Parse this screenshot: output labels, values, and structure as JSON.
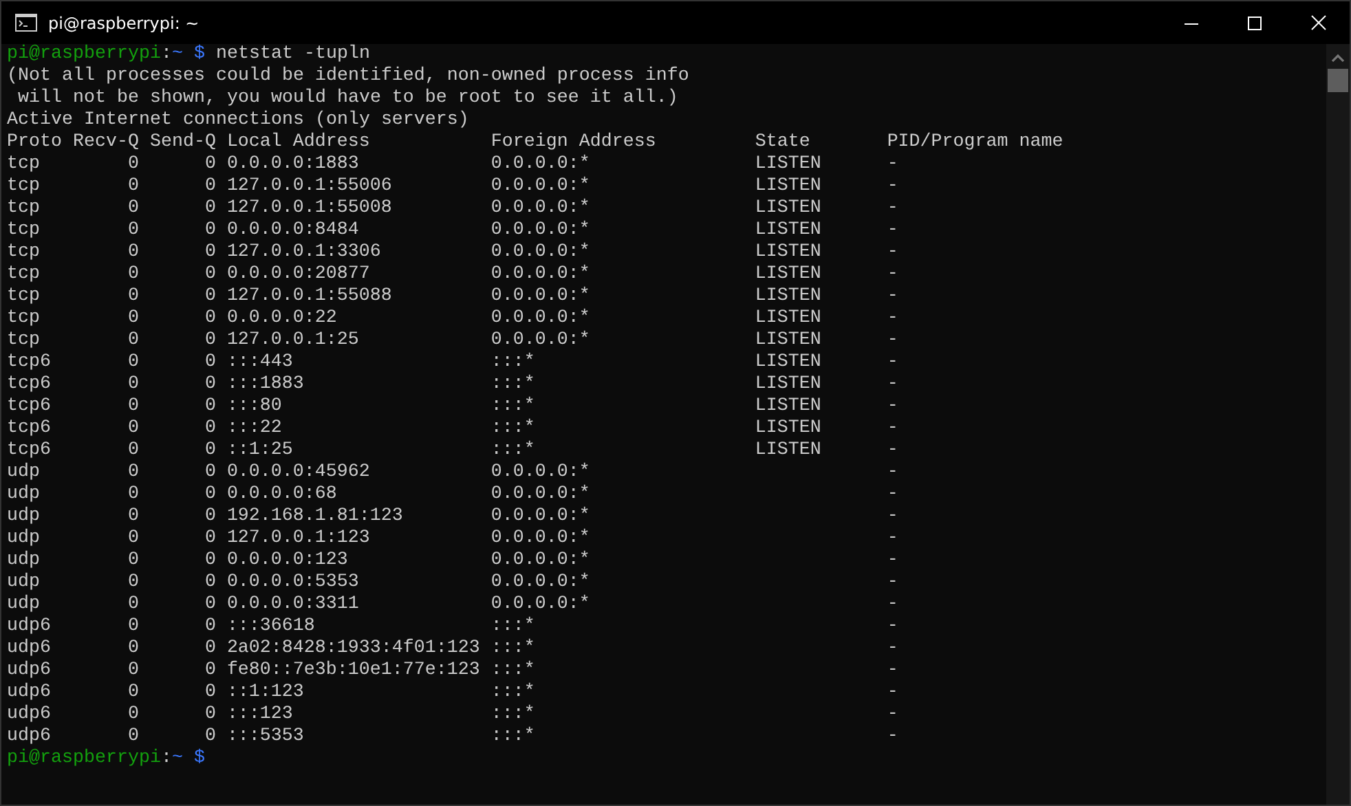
{
  "window": {
    "title": "pi@raspberrypi: ~"
  },
  "command": {
    "user_host": "pi@raspberrypi",
    "separator": ":",
    "path": "~",
    "symbol": "$",
    "text": "netstat -tupln"
  },
  "messages": [
    "(Not all processes could be identified, non-owned process info",
    " will not be shown, you would have to be root to see it all.)",
    "Active Internet connections (only servers)"
  ],
  "table": {
    "columns": [
      "Proto",
      "Recv-Q",
      "Send-Q",
      "Local Address",
      "Foreign Address",
      "State",
      "PID/Program name"
    ],
    "rows": [
      [
        "tcp",
        "0",
        "0",
        "0.0.0.0:1883",
        "0.0.0.0:*",
        "LISTEN",
        "-"
      ],
      [
        "tcp",
        "0",
        "0",
        "127.0.0.1:55006",
        "0.0.0.0:*",
        "LISTEN",
        "-"
      ],
      [
        "tcp",
        "0",
        "0",
        "127.0.0.1:55008",
        "0.0.0.0:*",
        "LISTEN",
        "-"
      ],
      [
        "tcp",
        "0",
        "0",
        "0.0.0.0:8484",
        "0.0.0.0:*",
        "LISTEN",
        "-"
      ],
      [
        "tcp",
        "0",
        "0",
        "127.0.0.1:3306",
        "0.0.0.0:*",
        "LISTEN",
        "-"
      ],
      [
        "tcp",
        "0",
        "0",
        "0.0.0.0:20877",
        "0.0.0.0:*",
        "LISTEN",
        "-"
      ],
      [
        "tcp",
        "0",
        "0",
        "127.0.0.1:55088",
        "0.0.0.0:*",
        "LISTEN",
        "-"
      ],
      [
        "tcp",
        "0",
        "0",
        "0.0.0.0:22",
        "0.0.0.0:*",
        "LISTEN",
        "-"
      ],
      [
        "tcp",
        "0",
        "0",
        "127.0.0.1:25",
        "0.0.0.0:*",
        "LISTEN",
        "-"
      ],
      [
        "tcp6",
        "0",
        "0",
        ":::443",
        ":::*",
        "LISTEN",
        "-"
      ],
      [
        "tcp6",
        "0",
        "0",
        ":::1883",
        ":::*",
        "LISTEN",
        "-"
      ],
      [
        "tcp6",
        "0",
        "0",
        ":::80",
        ":::*",
        "LISTEN",
        "-"
      ],
      [
        "tcp6",
        "0",
        "0",
        ":::22",
        ":::*",
        "LISTEN",
        "-"
      ],
      [
        "tcp6",
        "0",
        "0",
        "::1:25",
        ":::*",
        "LISTEN",
        "-"
      ],
      [
        "udp",
        "0",
        "0",
        "0.0.0.0:45962",
        "0.0.0.0:*",
        null,
        "-"
      ],
      [
        "udp",
        "0",
        "0",
        "0.0.0.0:68",
        "0.0.0.0:*",
        null,
        "-"
      ],
      [
        "udp",
        "0",
        "0",
        "192.168.1.81:123",
        "0.0.0.0:*",
        null,
        "-"
      ],
      [
        "udp",
        "0",
        "0",
        "127.0.0.1:123",
        "0.0.0.0:*",
        null,
        "-"
      ],
      [
        "udp",
        "0",
        "0",
        "0.0.0.0:123",
        "0.0.0.0:*",
        null,
        "-"
      ],
      [
        "udp",
        "0",
        "0",
        "0.0.0.0:5353",
        "0.0.0.0:*",
        null,
        "-"
      ],
      [
        "udp",
        "0",
        "0",
        "0.0.0.0:3311",
        "0.0.0.0:*",
        null,
        "-"
      ],
      [
        "udp6",
        "0",
        "0",
        ":::36618",
        ":::*",
        null,
        "-"
      ],
      [
        "udp6",
        "0",
        "0",
        "2a02:8428:1933:4f01:123",
        ":::*",
        null,
        "-"
      ],
      [
        "udp6",
        "0",
        "0",
        "fe80::7e3b:10e1:77e:123",
        ":::*",
        null,
        "-"
      ],
      [
        "udp6",
        "0",
        "0",
        "::1:123",
        ":::*",
        null,
        "-"
      ],
      [
        "udp6",
        "0",
        "0",
        ":::123",
        ":::*",
        null,
        "-"
      ],
      [
        "udp6",
        "0",
        "0",
        ":::5353",
        ":::*",
        null,
        "-"
      ]
    ]
  },
  "final_prompt": {
    "user_host": "pi@raspberrypi",
    "separator": ":",
    "path": "~",
    "symbol": "$"
  }
}
